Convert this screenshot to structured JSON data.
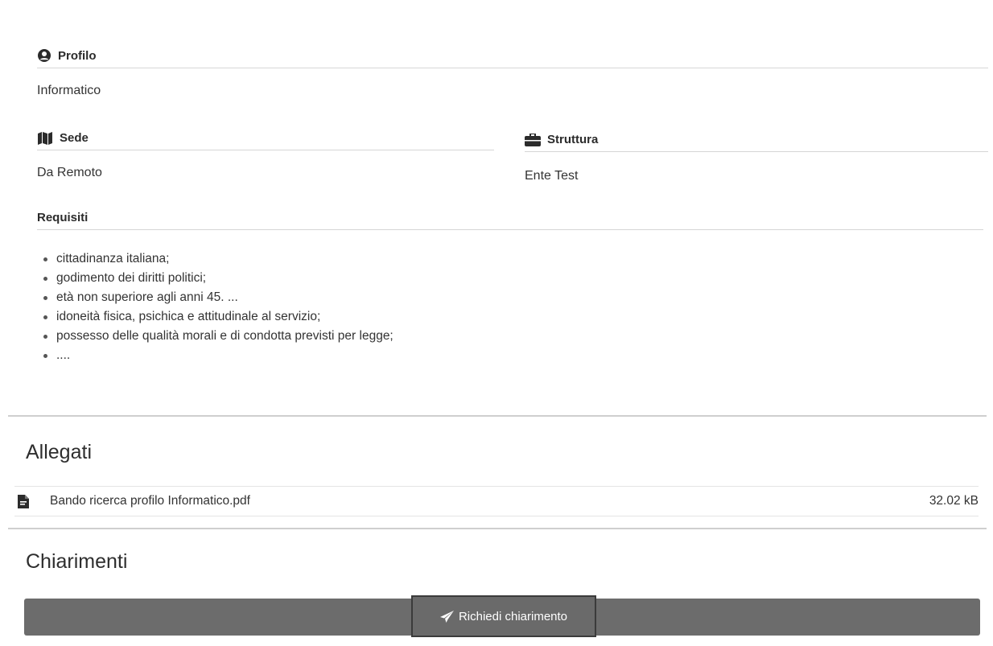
{
  "profilo": {
    "label": "Profilo",
    "value": "Informatico",
    "icon": "user-circle-icon"
  },
  "sede": {
    "label": "Sede",
    "value": "Da Remoto",
    "icon": "map-icon"
  },
  "struttura": {
    "label": "Struttura",
    "value": "Ente Test",
    "icon": "briefcase-icon"
  },
  "requisiti": {
    "label": "Requisiti",
    "items": [
      "cittadinanza italiana;",
      "godimento dei diritti politici;",
      "età non superiore agli anni 45. ...",
      "idoneità fisica, psichica e attitudinale al servizio;",
      "possesso delle qualità morali e di condotta previsti per legge;",
      "...."
    ]
  },
  "allegati": {
    "title": "Allegati",
    "files": [
      {
        "name": "Bando ricerca profilo Informatico.pdf",
        "size": "32.02 kB",
        "icon": "pdf-file-icon"
      }
    ]
  },
  "chiarimenti": {
    "title": "Chiarimenti",
    "button_label": "Richiedi chiarimento",
    "button_icon": "paper-plane-icon"
  }
}
